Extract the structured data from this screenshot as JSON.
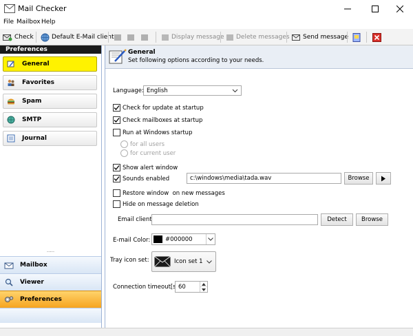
{
  "window": {
    "title": "Mail Checker"
  },
  "menu": [
    "File",
    "Mailbox",
    "Help"
  ],
  "toolbar": {
    "check": "Check",
    "default_client": "Default E-Mail client",
    "display_message": "Display message",
    "delete_messages": "Delete messages",
    "send_message": "Send message"
  },
  "sidebar": {
    "header": "Preferences",
    "items": [
      {
        "label": "General",
        "icon": "pencil-icon",
        "active": true
      },
      {
        "label": "Favorites",
        "icon": "people-icon"
      },
      {
        "label": "Spam",
        "icon": "hamburger-icon"
      },
      {
        "label": "SMTP",
        "icon": "smtp-globe-icon"
      },
      {
        "label": "Journal",
        "icon": "journal-icon"
      }
    ],
    "bottom": [
      {
        "label": "Mailbox",
        "icon": "mailbox-icon"
      },
      {
        "label": "Viewer",
        "icon": "magnifier-icon"
      },
      {
        "label": "Preferences",
        "icon": "gears-icon",
        "active": true
      }
    ]
  },
  "general": {
    "title": "General",
    "description": "Set following options according to your needs.",
    "language_label": "Language:",
    "language_value": "English",
    "check_updates": "Check for update at startup",
    "check_mailboxes": "Check mailboxes at startup",
    "run_startup": "Run at Windows startup",
    "for_all_users": "for all users",
    "for_current_user": "for current user",
    "show_alert": "Show alert window",
    "sounds_enabled": "Sounds enabled",
    "sound_path": "c:\\windows\\media\\tada.wav",
    "browse": "Browse",
    "restore_window": "Restore window  on new messages",
    "hide_on_delete": "Hide on message deletion",
    "email_client_label": "Email client:",
    "email_client_value": "",
    "detect": "Detect",
    "email_color_label": "E-mail Color:",
    "email_color_value": "#000000",
    "tray_icon_label": "Tray icon set:",
    "tray_icon_value": "Icon set 1",
    "timeout_label": "Connection timeout[s]:",
    "timeout_value": "60"
  },
  "colors": {
    "accent_yellow": "#fff200",
    "accent_orange": "#f6a420",
    "close_red": "#d9302a"
  }
}
